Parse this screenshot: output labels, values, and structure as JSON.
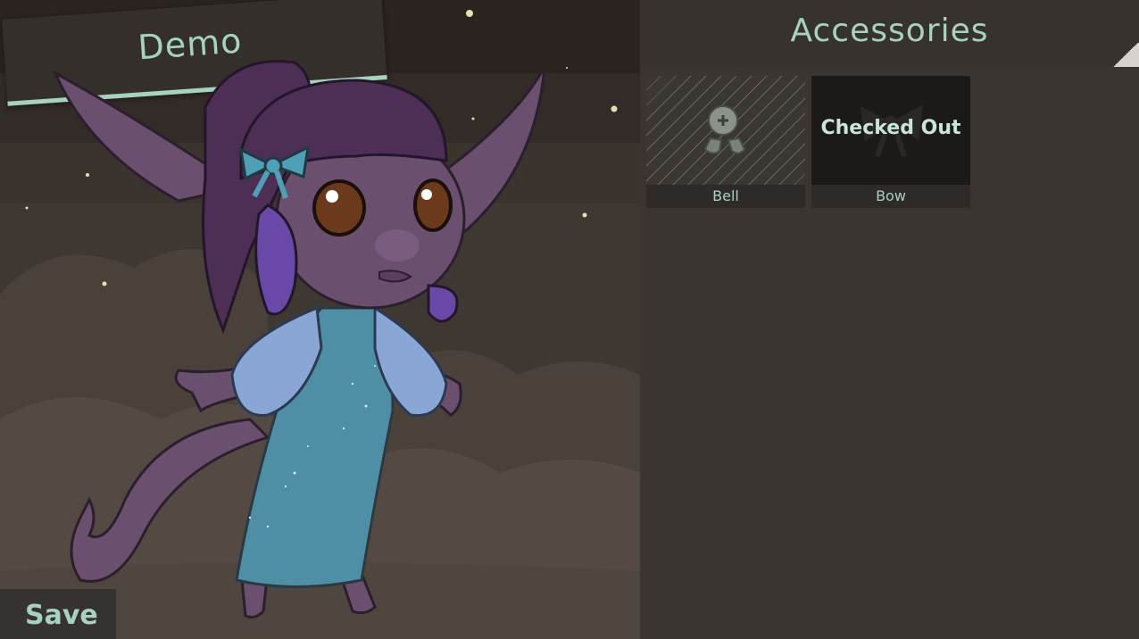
{
  "stage": {
    "name_tag": "Demo",
    "save_label": "Save"
  },
  "panel": {
    "title": "Accessories",
    "items": [
      {
        "label": "Bell",
        "status": ""
      },
      {
        "label": "Bow",
        "status": "Checked Out"
      }
    ]
  },
  "colors": {
    "accent": "#a6d2bf",
    "panel_bg": "#3a3531",
    "stage_bg": "#2a2320"
  }
}
